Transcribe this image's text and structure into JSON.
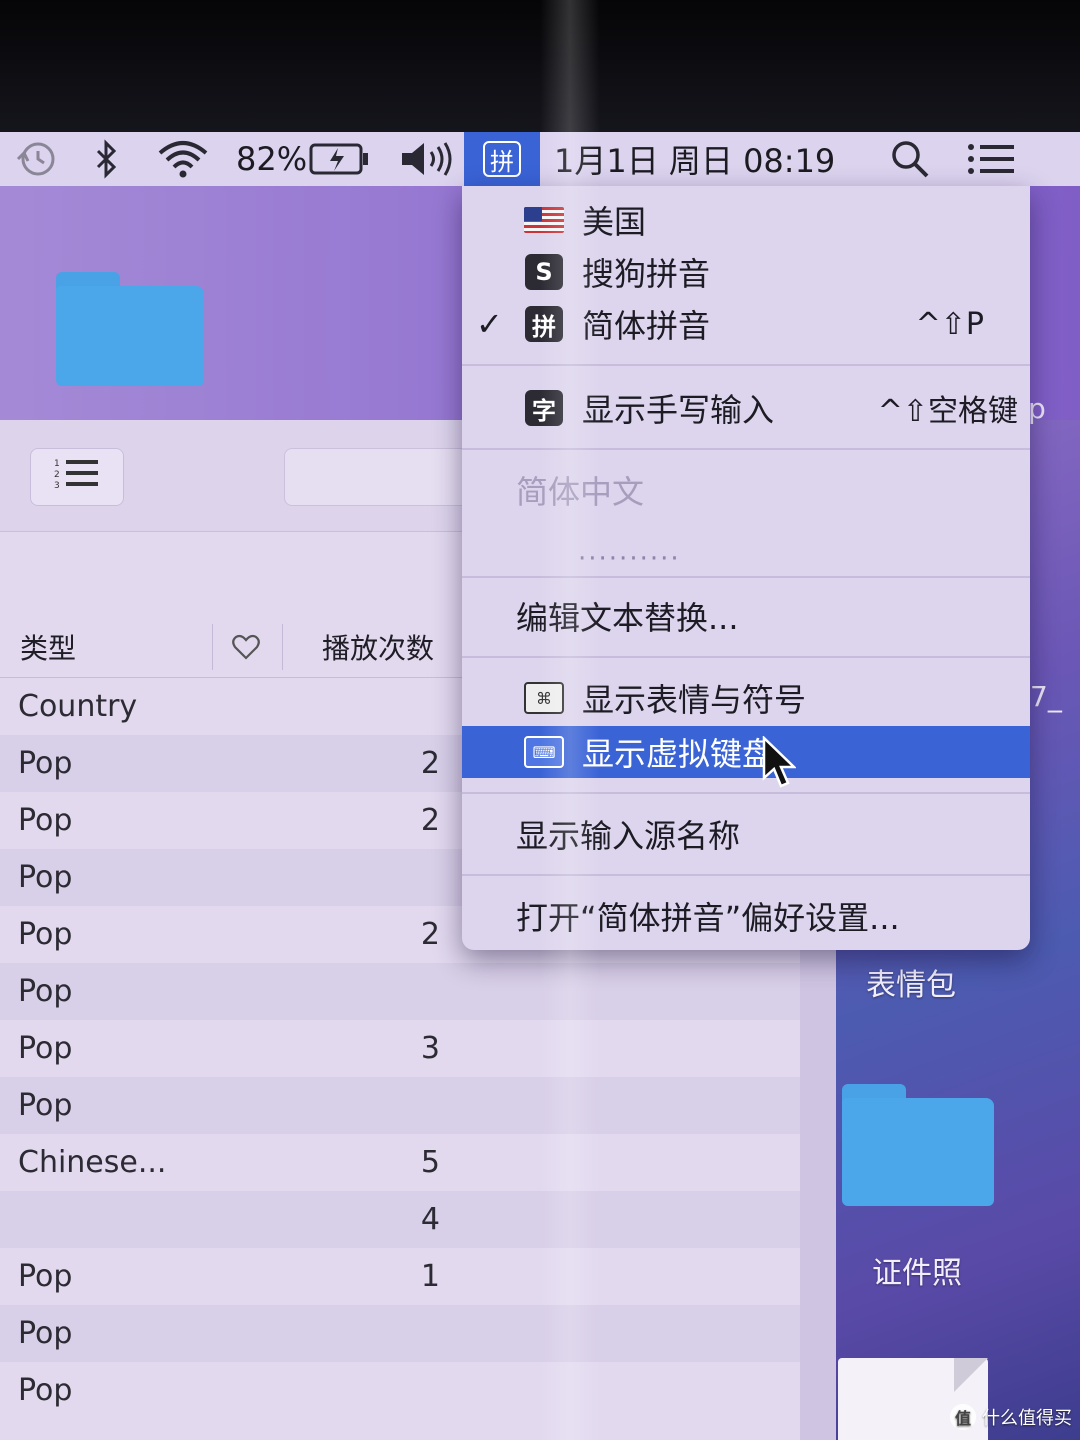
{
  "menubar": {
    "battery": "82%",
    "input_method_short": "拼",
    "datetime": "1月1日 周日 08:19",
    "icons": [
      "time-machine-icon",
      "bluetooth-icon",
      "wifi-icon",
      "battery-icon",
      "volume-icon",
      "spotlight-icon",
      "notification-icon"
    ]
  },
  "input_menu": {
    "sources": [
      {
        "label": "美国",
        "icon": "us-flag-icon",
        "checked": false,
        "shortcut": ""
      },
      {
        "label": "搜狗拼音",
        "icon": "sogou-icon",
        "checked": false,
        "shortcut": ""
      },
      {
        "label": "简体拼音",
        "icon": "pinyin-icon",
        "checked": true,
        "shortcut": "^⇧P"
      }
    ],
    "handwriting": {
      "label": "显示手写输入",
      "icon_glyph": "字",
      "shortcut": "^⇧空格键"
    },
    "section_title": "简体中文",
    "dots": "··········",
    "edit_text": "编辑文本替换...",
    "emoji": "显示表情与符号",
    "keyboard": "显示虚拟键盘",
    "show_name": "显示输入源名称",
    "open_prefs": "打开“简体拼音”偏好设置..."
  },
  "music_list": {
    "columns": {
      "genre": "类型",
      "plays": "播放次数"
    },
    "rows": [
      {
        "genre": "Country",
        "plays": ""
      },
      {
        "genre": "Pop",
        "plays": "2"
      },
      {
        "genre": "Pop",
        "plays": "2"
      },
      {
        "genre": "Pop",
        "plays": ""
      },
      {
        "genre": "Pop",
        "plays": "2"
      },
      {
        "genre": "Pop",
        "plays": ""
      },
      {
        "genre": "Pop",
        "plays": "3"
      },
      {
        "genre": "Pop",
        "plays": ""
      },
      {
        "genre": "Chinese...",
        "plays": "5"
      },
      {
        "genre": "",
        "plays": "4"
      },
      {
        "genre": "Pop",
        "plays": "1"
      },
      {
        "genre": "Pop",
        "plays": ""
      },
      {
        "genre": "Pop",
        "plays": ""
      }
    ]
  },
  "desktop": {
    "folder1_label": "表情包",
    "folder2_label": "证件照",
    "peek_right_1": "p",
    "peek_right_2": "7_"
  },
  "watermark": {
    "text": "什么值得买",
    "logo": "值"
  }
}
